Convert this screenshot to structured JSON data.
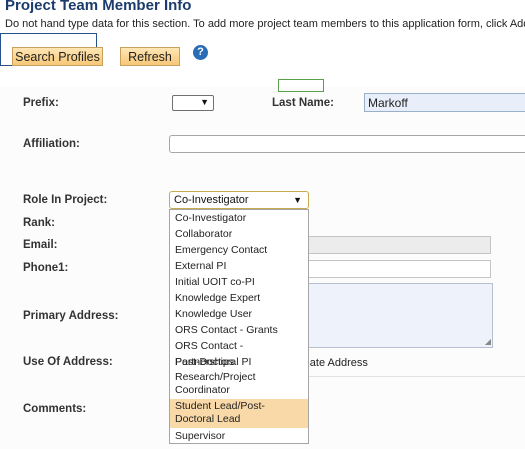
{
  "header": {
    "title": "Project Team Member Info",
    "instructions": "Do not hand type data for this section. To add more project team members to this application form, click Add N"
  },
  "toolbar": {
    "search_label": "Search Profiles",
    "refresh_label": "Refresh",
    "help_glyph": "?"
  },
  "form": {
    "prefix_label": "Prefix:",
    "last_name_label": "Last Name:",
    "last_name_value": "Markoff",
    "affiliation_label": "Affiliation:",
    "role_label": "Role In Project:",
    "role_value": "Co-Investigator",
    "rank_label": "Rank:",
    "email_label": "Email:",
    "phone_label": "Phone1:",
    "primary_address_label": "Primary Address:",
    "use_of_address_label": "Use Of Address:",
    "use_of_address_option": "rnate Address",
    "comments_label": "Comments:"
  },
  "role_options": [
    "Co-Investigator",
    "Collaborator",
    "Emergency Contact",
    "External PI",
    "Initial UOIT co-PI",
    "Knowledge Expert",
    "Knowledge User",
    "ORS Contact - Grants",
    "ORS Contact - Partnerships",
    "Post-Doctoral PI",
    "Research/Project Coordinator",
    "Student Lead/Post-Doctoral Lead",
    "Supervisor"
  ],
  "icons": {
    "dropdown_arrow": "▼",
    "resize": "◢"
  },
  "colors": {
    "title": "#1b3c6d",
    "button_bg": "#f7c777",
    "selected_option": "#f9d9a8",
    "help_icon": "#2a6cb5"
  }
}
